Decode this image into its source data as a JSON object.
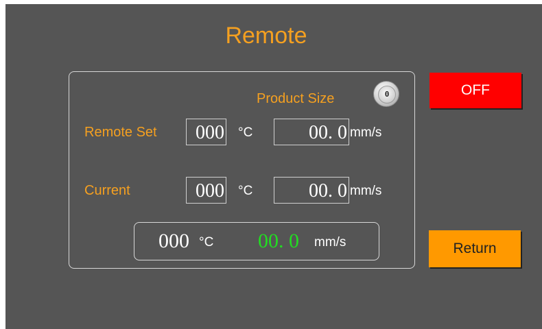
{
  "title": "Remote",
  "product_size": {
    "label": "Product Size",
    "value": "0"
  },
  "remote_set": {
    "label": "Remote Set",
    "temperature": "000",
    "temperature_unit": "°C",
    "speed": "00. 0",
    "speed_unit": "mm/s"
  },
  "current": {
    "label": "Current",
    "temperature": "000",
    "temperature_unit": "°C",
    "speed": "00. 0",
    "speed_unit": "mm/s"
  },
  "summary": {
    "temperature": "000",
    "temperature_unit": "°C",
    "speed": "00. 0",
    "speed_unit": "mm/s"
  },
  "buttons": {
    "off_label": "OFF",
    "return_label": "Return"
  },
  "colors": {
    "background": "#555555",
    "accent_orange": "#f5a020",
    "off_button": "#ff0000",
    "return_button": "#ff9900",
    "speed_highlight": "#22dd22"
  }
}
